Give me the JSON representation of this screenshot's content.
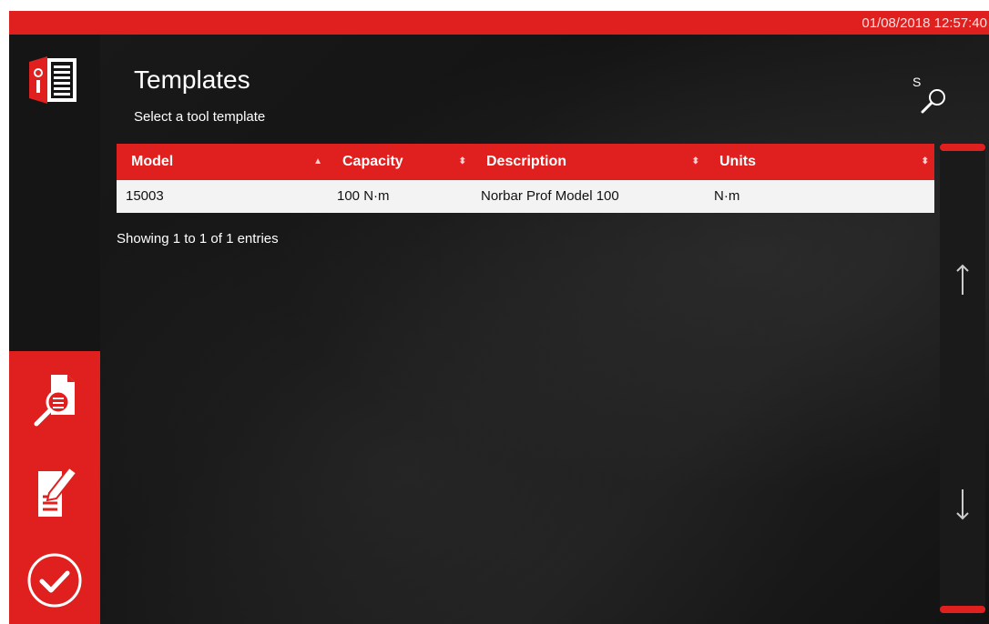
{
  "status_bar": {
    "datetime": "01/08/2018 12:57:40"
  },
  "header": {
    "title": "Templates",
    "subtitle": "Select a tool template",
    "search_shortcut": "S"
  },
  "table": {
    "columns": [
      "Model",
      "Capacity",
      "Description",
      "Units"
    ],
    "rows": [
      [
        "15003",
        "100 N·m",
        "Norbar Prof Model 100",
        "N·m"
      ]
    ],
    "entries_info": "Showing 1 to 1 of 1 entries"
  },
  "icons": {
    "logo": "document-logo-icon",
    "view_template": "magnifier-document-icon",
    "edit_template": "edit-document-icon",
    "confirm": "checkmark-circle-icon",
    "search": "search-icon",
    "scroll_up": "arrow-up-icon",
    "scroll_down": "arrow-down-icon"
  },
  "colors": {
    "accent": "#e0201e",
    "background": "#151515",
    "row_background": "#f3f3f3"
  }
}
